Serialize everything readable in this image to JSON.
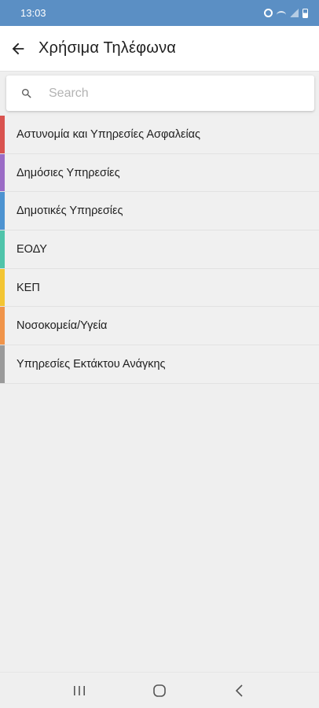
{
  "status_bar": {
    "time": "13:03",
    "icons": [
      "alarm-icon",
      "wifi-icon",
      "signal-icon",
      "battery-icon"
    ]
  },
  "app_bar": {
    "back_icon": "arrow-left-icon",
    "title": "Χρήσιμα Τηλέφωνα"
  },
  "search": {
    "icon": "search-icon",
    "placeholder": "Search",
    "value": ""
  },
  "categories": [
    {
      "label": "Αστυνομία και Υπηρεσίες Ασφαλείας",
      "color": "#d9534f"
    },
    {
      "label": "Δημόσιες Υπηρεσίες",
      "color": "#9b6cc6"
    },
    {
      "label": "Δημοτικές Υπηρεσίες",
      "color": "#4d93d1"
    },
    {
      "label": "ΕΟΔΥ",
      "color": "#4fc4aa"
    },
    {
      "label": "ΚΕΠ",
      "color": "#f3c533"
    },
    {
      "label": "Νοσοκομεία/Υγεία",
      "color": "#f0944a"
    },
    {
      "label": "Υπηρεσίες Εκτάκτου Ανάγκης",
      "color": "#9a9a9a"
    }
  ],
  "nav_bar": {
    "recents_icon": "recents-icon",
    "home_icon": "home-icon",
    "back_icon": "chevron-left-icon"
  },
  "colors": {
    "status_bar": "#5b8fc4",
    "app_bar": "#ffffff",
    "background": "#efefef"
  }
}
